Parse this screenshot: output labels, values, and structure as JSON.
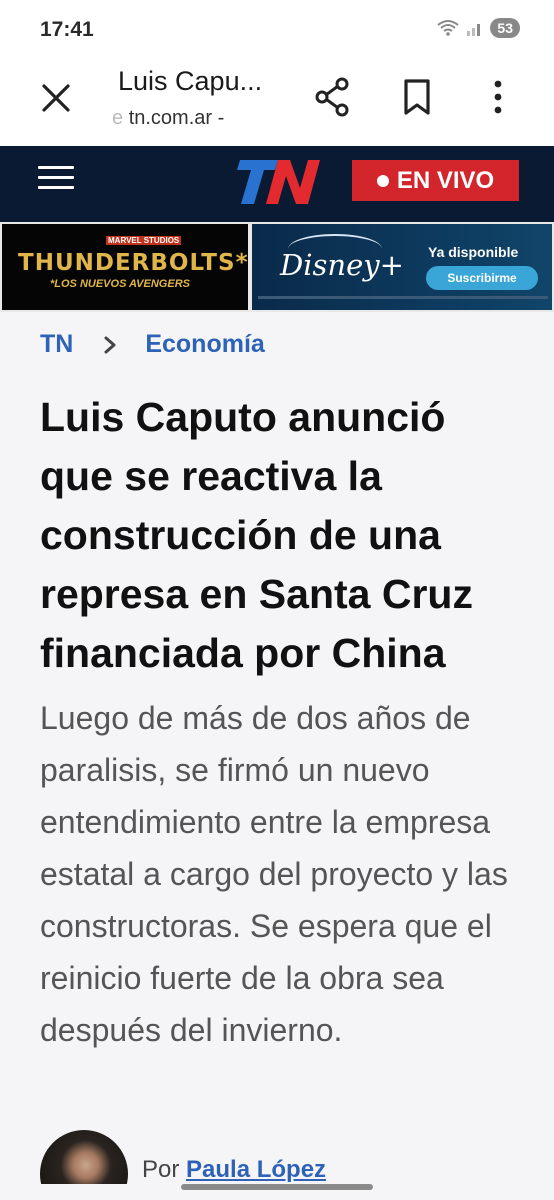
{
  "status_bar": {
    "time": "17:41",
    "battery": "53",
    "icons": [
      "wifi-icon",
      "signal-icon",
      "battery-icon"
    ]
  },
  "browser_toolbar": {
    "title": "Luis Capu...",
    "url": "tn.com.ar",
    "url_suffix": " -"
  },
  "site_header": {
    "logo": "TN",
    "live_label": "EN VIVO"
  },
  "ad": {
    "brand": "MARVEL STUDIOS",
    "title": "THUNDERBOLTS*",
    "subtitle": "*LOS NUEVOS AVENGERS",
    "service": "Disney+",
    "available": "Ya disponible",
    "cta": "Suscribirme"
  },
  "breadcrumb": {
    "home": "TN",
    "section": "Economía"
  },
  "article": {
    "headline": "Luis Caputo anunció que se reactiva la construcción de una represa en Santa Cruz financiada por China",
    "summary": "Luego de más de dos años de paralisis, se firmó un nuevo entendimiento entre la empresa estatal a cargo del proyecto y las constructoras. Se espera que el reinicio fuerte de la obra sea después del invierno."
  },
  "author": {
    "prefix": "Por ",
    "name": "Paula López"
  },
  "colors": {
    "header_bg": "#0b1a33",
    "live_red": "#d3262c",
    "link_blue": "#2d62b7",
    "page_bg": "#f5f5f7"
  }
}
